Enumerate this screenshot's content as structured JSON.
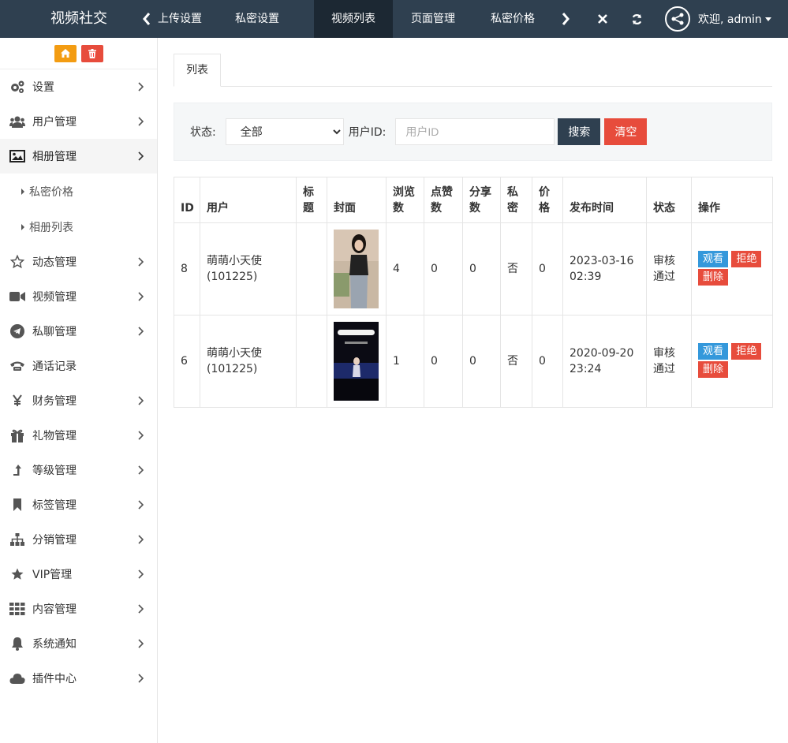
{
  "header": {
    "brand": "视频社交",
    "tabs": [
      {
        "label": "上传设置",
        "active": false
      },
      {
        "label": "私密设置",
        "active": false
      },
      {
        "label": "视频列表",
        "active": true
      },
      {
        "label": "页面管理",
        "active": false
      },
      {
        "label": "私密价格",
        "active": false
      }
    ],
    "icons": [
      "chevron-left-icon",
      "chevron-right-icon",
      "close-icon",
      "refresh-icon",
      "share-icon"
    ],
    "user_greeting": "欢迎, admin"
  },
  "sidebar": {
    "actions": [
      {
        "icon": "home-icon",
        "color": "#f39c12"
      },
      {
        "icon": "trash-icon",
        "color": "#e74c3c"
      }
    ],
    "items": [
      {
        "label": "设置",
        "icon": "gears-icon"
      },
      {
        "label": "用户管理",
        "icon": "users-icon"
      },
      {
        "label": "相册管理",
        "icon": "picture-icon",
        "active": true
      },
      {
        "label": "动态管理",
        "icon": "star-outline-icon"
      },
      {
        "label": "视频管理",
        "icon": "video-camera-icon"
      },
      {
        "label": "私聊管理",
        "icon": "telegram-icon"
      },
      {
        "label": "通话记录",
        "icon": "phone-icon"
      },
      {
        "label": "财务管理",
        "icon": "yen-icon"
      },
      {
        "label": "礼物管理",
        "icon": "gift-icon"
      },
      {
        "label": "等级管理",
        "icon": "level-up-icon"
      },
      {
        "label": "标签管理",
        "icon": "bookmark-icon"
      },
      {
        "label": "分销管理",
        "icon": "sitemap-icon"
      },
      {
        "label": "VIP管理",
        "icon": "star-icon"
      },
      {
        "label": "内容管理",
        "icon": "grid-icon"
      },
      {
        "label": "系统通知",
        "icon": "bell-icon"
      },
      {
        "label": "插件中心",
        "icon": "cloud-icon"
      }
    ],
    "subitems": [
      {
        "label": "私密价格"
      },
      {
        "label": "相册列表"
      }
    ]
  },
  "main": {
    "tab_label": "列表",
    "filter": {
      "status_label": "状态:",
      "status_value": "全部",
      "userid_label": "用户ID:",
      "userid_placeholder": "用户ID",
      "search_label": "搜索",
      "clear_label": "清空"
    },
    "table": {
      "headers": [
        "ID",
        "用户",
        "标题",
        "封面",
        "浏览数",
        "点赞数",
        "分享数",
        "私密",
        "价格",
        "发布时间",
        "状态",
        "操作"
      ],
      "rows": [
        {
          "id": "8",
          "user": "萌萌小天使(101225)",
          "title": "",
          "views": "4",
          "likes": "0",
          "shares": "0",
          "private": "否",
          "price": "0",
          "time": "2023-03-16 02:39",
          "status": "审核通过"
        },
        {
          "id": "6",
          "user": "萌萌小天使(101225)",
          "title": "",
          "views": "1",
          "likes": "0",
          "shares": "0",
          "private": "否",
          "price": "0",
          "time": "2020-09-20 23:24",
          "status": "审核通过"
        }
      ],
      "actions": {
        "watch": "观看",
        "reject": "拒绝",
        "delete": "删除"
      }
    }
  },
  "colors": {
    "topbar": "#2f4050",
    "active_tab": "#1c2833",
    "primary": "#3498db",
    "danger": "#e74c3c",
    "warning": "#f39c12"
  }
}
